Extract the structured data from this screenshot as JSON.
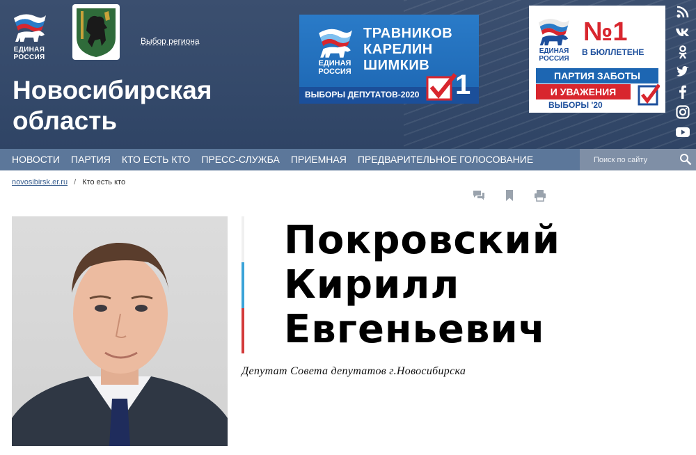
{
  "header": {
    "party_logo_text": [
      "ЕДИНАЯ",
      "РОССИЯ"
    ],
    "region_link": "Выбор региона",
    "site_title_lines": [
      "Новосибирская",
      "область"
    ],
    "colors": {
      "header_bg": "#3b4f6f",
      "nav_bg": "#5c779a",
      "brand_blue": "#1d66b2",
      "brand_red": "#d8262e"
    }
  },
  "banners": {
    "first": {
      "logo_text": [
        "ЕДИНАЯ",
        "РОССИЯ"
      ],
      "names": [
        "ТРАВНИКОВ",
        "КАРЕЛИН",
        "ШИМКИВ"
      ],
      "footer": "ВЫБОРЫ ДЕПУТАТОВ-2020",
      "number": "1"
    },
    "second": {
      "logo_text": [
        "ЕДИНАЯ",
        "РОССИЯ"
      ],
      "headline": "№1",
      "subline": "В БЮЛЛЕТЕНЕ",
      "line1": "ПАРТИЯ ЗАБОТЫ",
      "line2": "И УВАЖЕНИЯ",
      "footer": "ВЫБОРЫ '20"
    }
  },
  "social": [
    "rss-icon",
    "vk-icon",
    "odnoklassniki-icon",
    "twitter-icon",
    "facebook-icon",
    "instagram-icon",
    "youtube-icon"
  ],
  "nav": {
    "items": [
      "НОВОСТИ",
      "ПАРТИЯ",
      "КТО ЕСТЬ КТО",
      "ПРЕСС-СЛУЖБА",
      "ПРИЕМНАЯ",
      "ПРЕДВАРИТЕЛЬНОЕ ГОЛОСОВАНИЕ"
    ],
    "search_placeholder": "Поиск по сайту"
  },
  "breadcrumb": {
    "home": "novosibirsk.er.ru",
    "separator": "/",
    "current": "Кто есть кто"
  },
  "tools": [
    "comments-icon",
    "bookmark-icon",
    "print-icon"
  ],
  "person": {
    "name_lines": [
      "Покровский",
      "Кирилл",
      "Евгеньевич"
    ],
    "position": "Депутат Совета депутатов г.Новосибирска"
  }
}
